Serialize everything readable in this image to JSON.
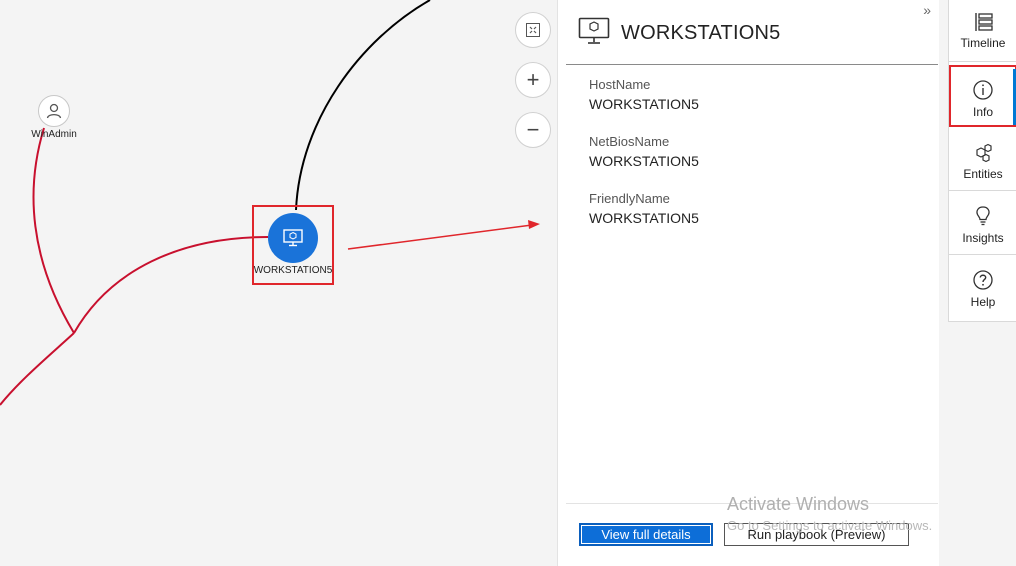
{
  "graph": {
    "nodes": [
      {
        "id": "user",
        "label": "WinAdmin",
        "icon": "user-icon"
      },
      {
        "id": "workstation",
        "label": "WORKSTATION5",
        "icon": "monitor-icon",
        "selected": true
      }
    ],
    "zoom_controls": [
      {
        "id": "fit",
        "icon": "fit-to-screen-icon",
        "glyph": "⛶"
      },
      {
        "id": "zoom_in",
        "icon": "plus-icon",
        "glyph": "+"
      },
      {
        "id": "zoom_out",
        "icon": "minus-icon",
        "glyph": "−"
      }
    ],
    "colors": {
      "edge_alert": "#c8102e",
      "edge_normal": "#000000",
      "node_selected": "#1a73d9",
      "highlight": "#e0262b"
    }
  },
  "panel": {
    "collapse_glyph": "»",
    "title": "WORKSTATION5",
    "header_icon": "monitor-icon",
    "properties": [
      {
        "label": "HostName",
        "value": "WORKSTATION5"
      },
      {
        "label": "NetBiosName",
        "value": "WORKSTATION5"
      },
      {
        "label": "FriendlyName",
        "value": "WORKSTATION5"
      }
    ],
    "buttons": {
      "view_details": "View full details",
      "run_playbook": "Run playbook (Preview)"
    }
  },
  "rail": {
    "items": [
      {
        "label": "Timeline",
        "icon": "timeline-icon"
      },
      {
        "label": "Info",
        "icon": "info-icon",
        "active": true
      },
      {
        "label": "Entities",
        "icon": "entities-icon"
      },
      {
        "label": "Insights",
        "icon": "lightbulb-icon"
      },
      {
        "label": "Help",
        "icon": "help-icon"
      }
    ]
  },
  "watermark": {
    "line1": "Activate Windows",
    "line2": "Go to Settings to activate Windows."
  }
}
